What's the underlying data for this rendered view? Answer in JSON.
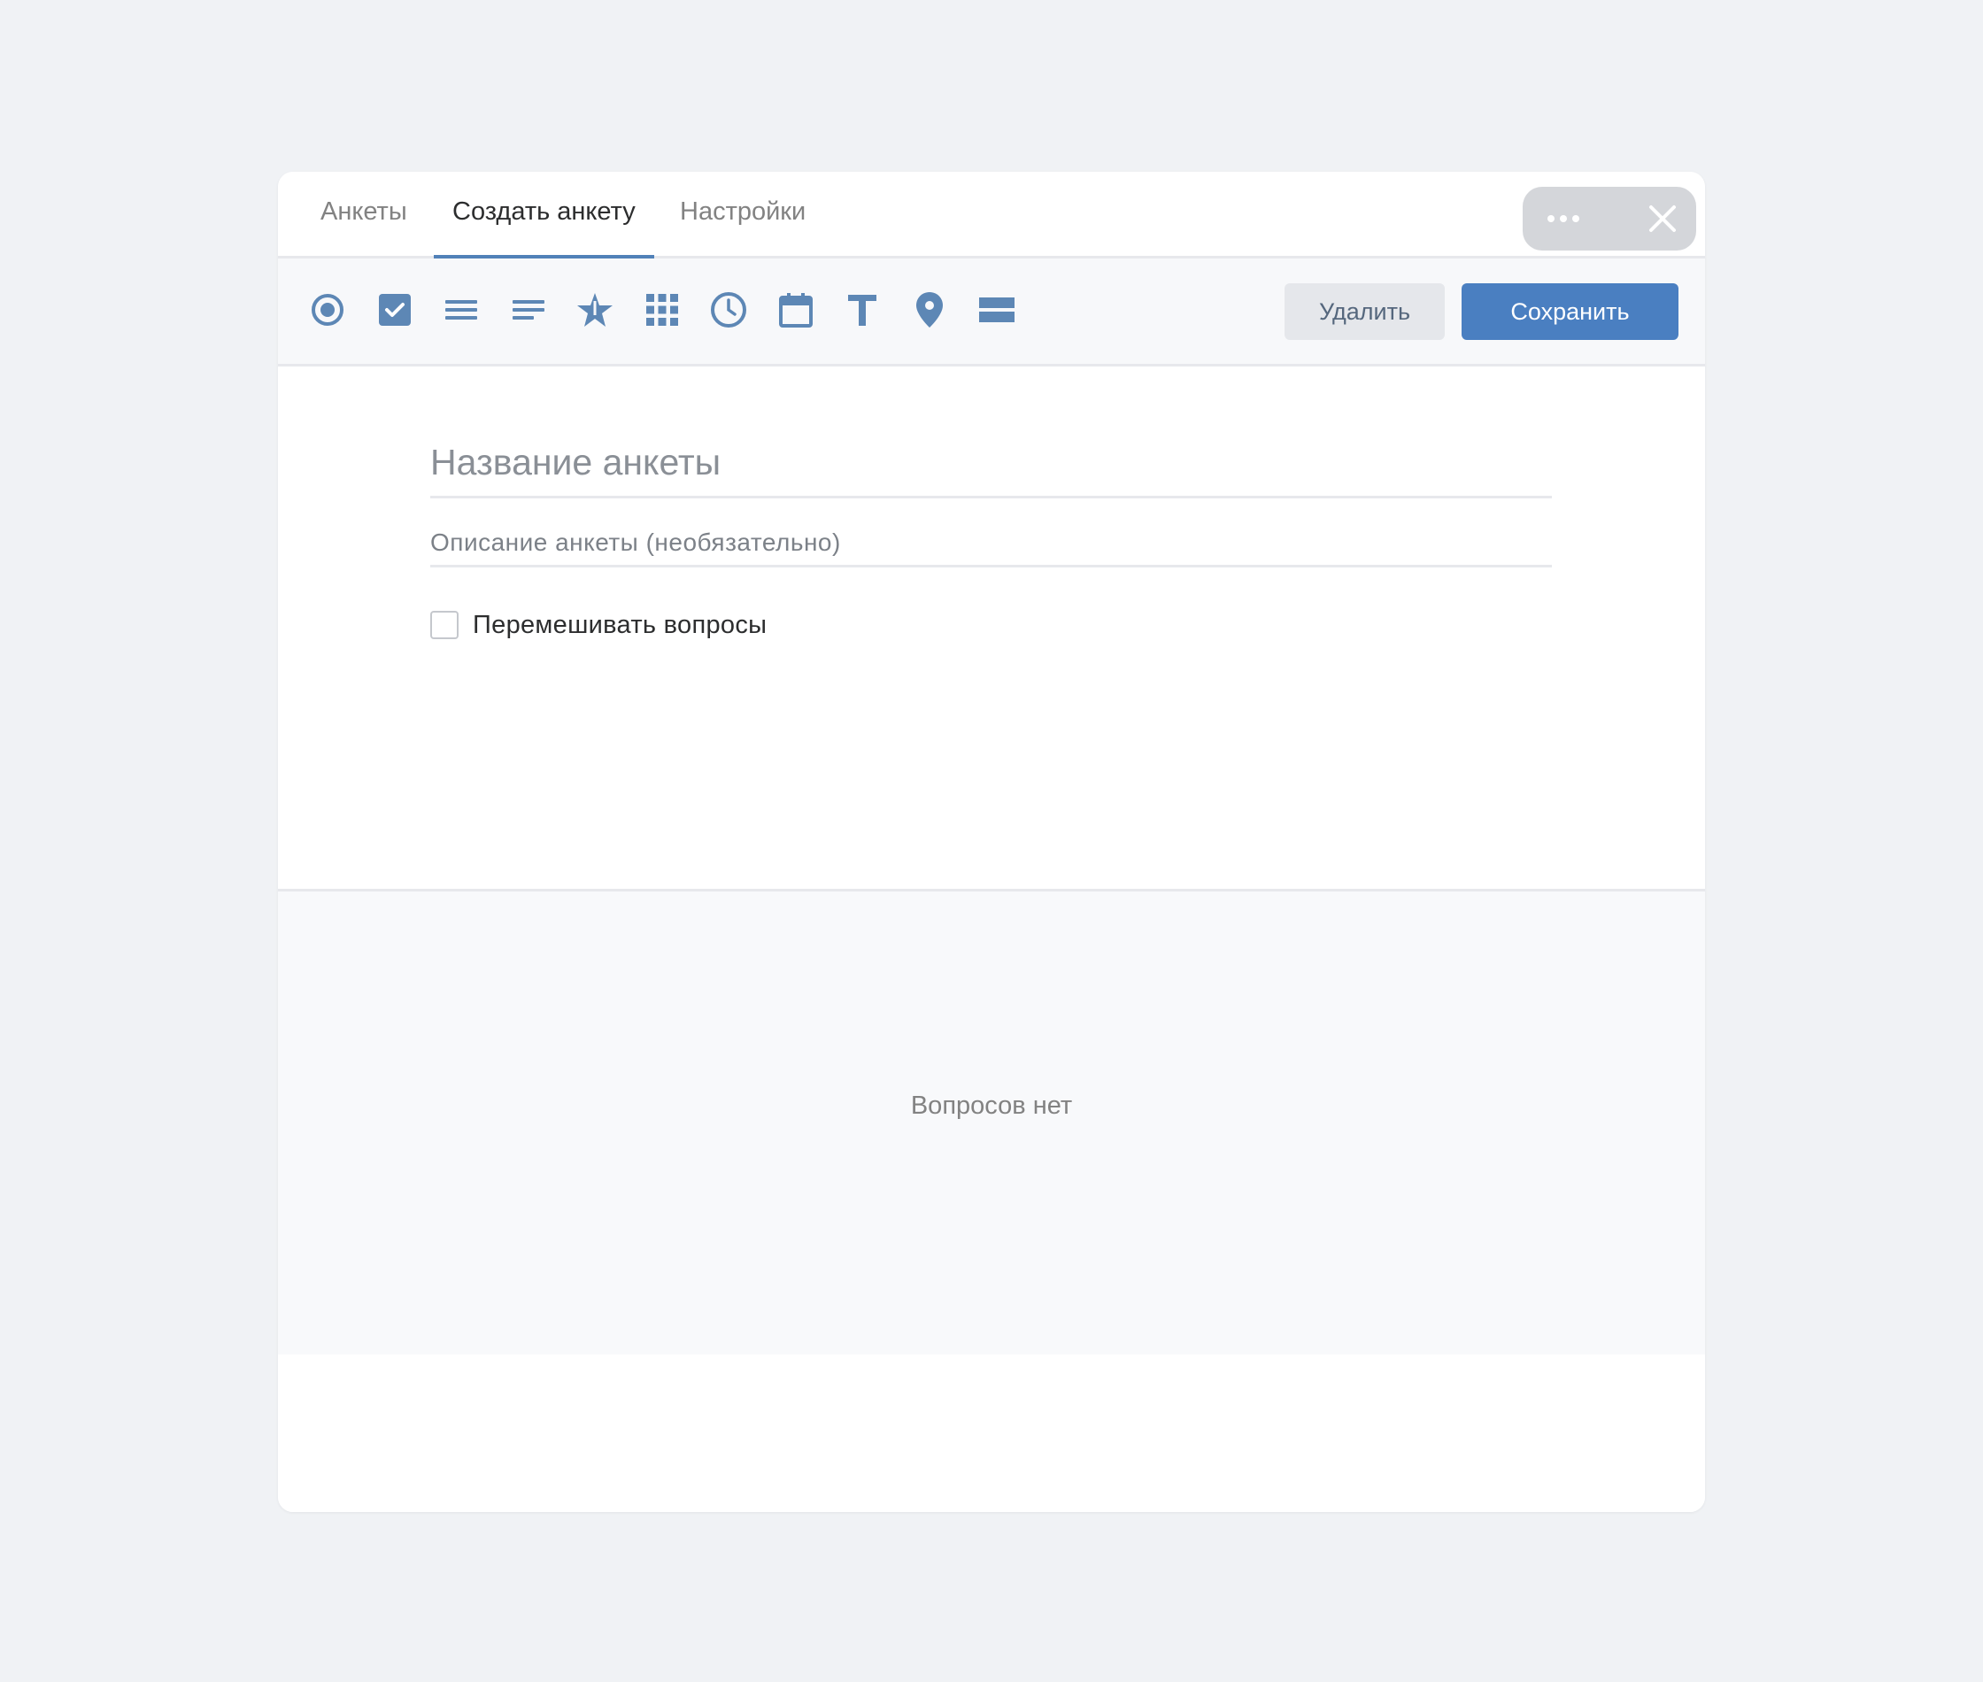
{
  "tabs": [
    {
      "label": "Анкеты"
    },
    {
      "label": "Создать анкету"
    },
    {
      "label": "Настройки"
    }
  ],
  "toolbar": {
    "tools": [
      "radio-icon",
      "checkbox-icon",
      "list-icon",
      "text-lines-icon",
      "star-icon",
      "grid-icon",
      "clock-icon",
      "calendar-icon",
      "text-icon",
      "location-pin-icon",
      "section-icon"
    ],
    "delete_label": "Удалить",
    "save_label": "Сохранить"
  },
  "form": {
    "title_placeholder": "Название анкеты",
    "description_placeholder": "Описание анкеты (необязательно)",
    "shuffle_label": "Перемешивать вопросы",
    "shuffle_checked": false
  },
  "questions": {
    "empty_text": "Вопросов нет"
  },
  "colors": {
    "accent": "#5181b8",
    "save_button": "#4a7fc1",
    "icon": "#5d87b5",
    "background": "#f0f2f5"
  }
}
